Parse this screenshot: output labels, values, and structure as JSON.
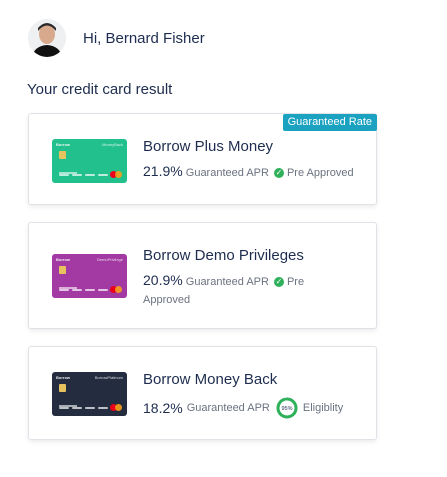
{
  "greeting": "Hi, Bernard Fisher",
  "section_title": "Your credit card result",
  "cards": [
    {
      "badge": "Guaranteed Rate",
      "title": "Borrow Plus Money",
      "apr": "21.9%",
      "apr_label": "Guaranteed APR",
      "status": "Pre Approved",
      "card_color": "#22c08c",
      "card_brand": "Borrow",
      "card_name": "MoneyBack"
    },
    {
      "title": "Borrow Demo Privileges",
      "apr": "20.9%",
      "apr_label": "Guaranteed APR",
      "status": "Pre Approved",
      "card_color": "#a33aa3",
      "card_brand": "Borrow",
      "card_name": "DemoPrivilege"
    },
    {
      "title": "Borrow Money Back",
      "apr": "18.2%",
      "apr_label": "Guaranteed APR",
      "eligibility_percent": 95,
      "eligibility_percent_label": "95%",
      "eligibility_label": "Eligiblity",
      "card_color": "#232d3f",
      "card_brand": "Borrow",
      "card_name": "BorrowPlatinum"
    }
  ],
  "colors": {
    "badge": "#1aa2c0",
    "check": "#2eb15a",
    "ring": "#2eb15a"
  }
}
